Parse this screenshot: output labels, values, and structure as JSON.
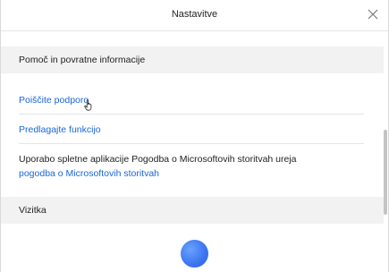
{
  "window": {
    "title": "Nastavitve"
  },
  "sections": {
    "help": {
      "header": "Pomoč in povratne informacije",
      "links": {
        "support": "Poiščite podporo",
        "feature": "Predlagajte funkcijo"
      },
      "terms": {
        "text": "Uporabo spletne aplikacije Pogodba o Microsoftovih storitvah ureja",
        "link": "pogodba o Microsoftovih storitvah"
      }
    },
    "card": {
      "header": "Vizitka"
    }
  }
}
